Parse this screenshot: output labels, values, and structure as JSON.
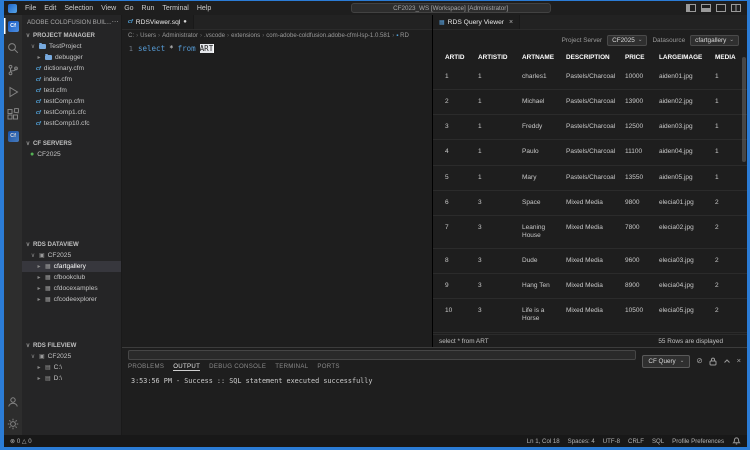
{
  "window": {
    "title": "CF2023_WS [Workspace] [Administrator]",
    "menu_items": [
      {
        "label": "File"
      },
      {
        "label": "Edit"
      },
      {
        "label": "Selection"
      },
      {
        "label": "View"
      },
      {
        "label": "Go"
      },
      {
        "label": "Run"
      },
      {
        "label": "Terminal"
      },
      {
        "label": "Help"
      }
    ]
  },
  "icons": {
    "more": "⋯",
    "close": "×",
    "chevron_down": "⌄",
    "section_chevron": "∨",
    "collapsed": "▸",
    "modified": "●",
    "server_dot": "●",
    "grid": "▦",
    "drive": "▤",
    "db": "▣",
    "clear": "⊘",
    "errors": "⊗",
    "warnings": "△",
    "cf_file": "cf",
    "tab_file": "▦"
  },
  "activity_bar": {
    "items": [
      "coldfusion-builder",
      "search",
      "source-control",
      "run-debug",
      "extensions",
      "coldfusion",
      "account",
      "settings"
    ]
  },
  "sidebar": {
    "header": "ADOBE COLDFUSION BUIL...",
    "project_manager": {
      "label": "PROJECT MANAGER",
      "root": "TestProject",
      "folder": "debugger",
      "files": [
        {
          "name": "dictionary.cfm"
        },
        {
          "name": "index.cfm"
        },
        {
          "name": "test.cfm"
        },
        {
          "name": "testComp.cfm"
        },
        {
          "name": "testComp1.cfc"
        },
        {
          "name": "testComp10.cfc"
        }
      ]
    },
    "cf_servers": {
      "label": "CF SERVERS",
      "server": "CF2025"
    },
    "rds_dataview": {
      "label": "RDS DATAVIEW",
      "root": "CF2025",
      "items": [
        {
          "name": "cfartgallery"
        },
        {
          "name": "cfbookclub"
        },
        {
          "name": "cfdocexamples"
        },
        {
          "name": "cfcodeexplorer"
        }
      ]
    },
    "rds_fileview": {
      "label": "RDS FILEVIEW",
      "root": "CF2025",
      "items": [
        {
          "name": "C:\\"
        },
        {
          "name": "D:\\"
        }
      ]
    }
  },
  "editor": {
    "tab_filename": "RDSViewer.sql",
    "breadcrumbs": [
      {
        "label": "C:"
      },
      {
        "label": "Users"
      },
      {
        "label": "Administrator"
      },
      {
        "label": ".vscode"
      },
      {
        "label": "extensions"
      },
      {
        "label": "com-adobe-coldfusion.adobe-cfml-lsp-1.0.581"
      },
      {
        "label": "RD"
      }
    ],
    "line_number": "1",
    "code": {
      "keyword1": "select",
      "star": "*",
      "keyword2": "from",
      "table": "ART"
    }
  },
  "query_viewer": {
    "tab_title": "RDS Query Viewer",
    "toolbar": {
      "server_label": "Project Server",
      "server_value": "CF2025",
      "datasource_label": "Datasource",
      "datasource_value": "cfartgallery"
    },
    "table": {
      "columns": [
        {
          "label": "ARTID"
        },
        {
          "label": "ARTISTID"
        },
        {
          "label": "ARTNAME"
        },
        {
          "label": "DESCRIPTION"
        },
        {
          "label": "PRICE"
        },
        {
          "label": "LARGEIMAGE"
        },
        {
          "label": "MEDIA"
        }
      ],
      "rows": [
        {
          "artid": "1",
          "artistid": "1",
          "artname": "charles1",
          "description": "Pastels/Charcoal",
          "price": "10000",
          "largeimage": "aiden01.jpg",
          "media": "1"
        },
        {
          "artid": "2",
          "artistid": "1",
          "artname": "Michael",
          "description": "Pastels/Charcoal",
          "price": "13900",
          "largeimage": "aiden02.jpg",
          "media": "1"
        },
        {
          "artid": "3",
          "artistid": "1",
          "artname": "Freddy",
          "description": "Pastels/Charcoal",
          "price": "12500",
          "largeimage": "aiden03.jpg",
          "media": "1"
        },
        {
          "artid": "4",
          "artistid": "1",
          "artname": "Paulo",
          "description": "Pastels/Charcoal",
          "price": "11100",
          "largeimage": "aiden04.jpg",
          "media": "1"
        },
        {
          "artid": "5",
          "artistid": "1",
          "artname": "Mary",
          "description": "Pastels/Charcoal",
          "price": "13550",
          "largeimage": "aiden05.jpg",
          "media": "1"
        },
        {
          "artid": "6",
          "artistid": "3",
          "artname": "Space",
          "description": "Mixed Media",
          "price": "9800",
          "largeimage": "elecia01.jpg",
          "media": "2"
        },
        {
          "artid": "7",
          "artistid": "3",
          "artname": "Leaning House",
          "description": "Mixed Media",
          "price": "7800",
          "largeimage": "elecia02.jpg",
          "media": "2"
        },
        {
          "artid": "8",
          "artistid": "3",
          "artname": "Dude",
          "description": "Mixed Media",
          "price": "9600",
          "largeimage": "elecia03.jpg",
          "media": "2"
        },
        {
          "artid": "9",
          "artistid": "3",
          "artname": "Hang Ten",
          "description": "Mixed Media",
          "price": "8900",
          "largeimage": "elecia04.jpg",
          "media": "2"
        },
        {
          "artid": "10",
          "artistid": "3",
          "artname": "Life is a Horse",
          "description": "Mixed Media",
          "price": "10500",
          "largeimage": "elecia05.jpg",
          "media": "2"
        }
      ]
    },
    "status": {
      "query": "select * from ART",
      "rows_info": "55 Rows are displayed"
    }
  },
  "panel": {
    "tabs": [
      {
        "label": "PROBLEMS"
      },
      {
        "label": "OUTPUT"
      },
      {
        "label": "DEBUG CONSOLE"
      },
      {
        "label": "TERMINAL"
      },
      {
        "label": "PORTS"
      }
    ],
    "channel": "CF Query",
    "output_line": "3:53:56 PM - Success :: SQL statement executed successfully"
  },
  "status_bar": {
    "errors": "0",
    "warnings": "0",
    "items": [
      {
        "label": "Ln 1, Col 18"
      },
      {
        "label": "Spaces: 4"
      },
      {
        "label": "UTF-8"
      },
      {
        "label": "CRLF"
      },
      {
        "label": "SQL"
      },
      {
        "label": "Profile Preferences"
      }
    ]
  },
  "colors": {
    "window_border": "#2b7cd6",
    "keyword": "#569cd6",
    "selection_row": "#37373d",
    "server_ok": "#54b054"
  }
}
